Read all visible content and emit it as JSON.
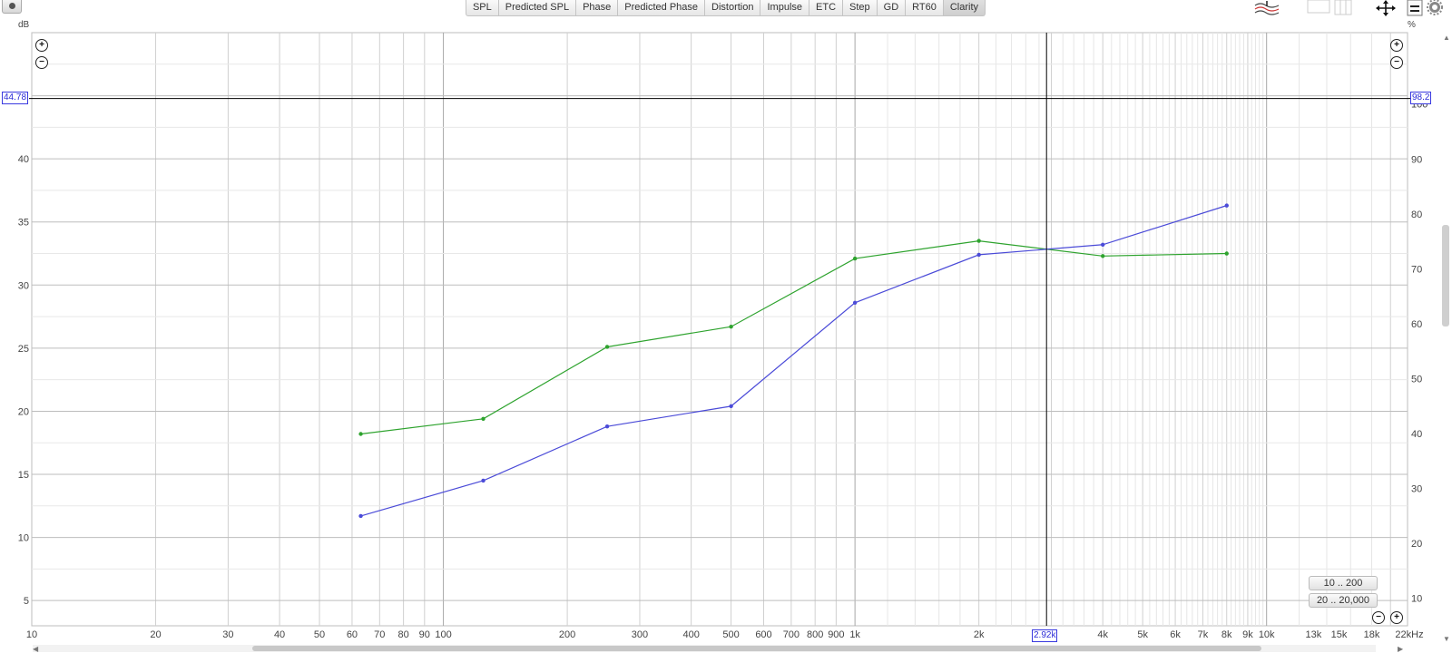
{
  "toolbar": {
    "tabs": [
      "SPL",
      "Predicted SPL",
      "Phase",
      "Predicted Phase",
      "Distortion",
      "Impulse",
      "ETC",
      "Step",
      "GD",
      "RT60",
      "Clarity"
    ],
    "active_tab": "Clarity"
  },
  "axes": {
    "left_unit": "dB",
    "right_unit": "%",
    "x_unit_label": "22kHz"
  },
  "cursor": {
    "y_left": "44.78",
    "y_right": "98.2",
    "x": "2.92k"
  },
  "range_buttons": [
    "10 .. 200",
    "20 .. 20,000"
  ],
  "colors": {
    "series_green": "#2ea32e",
    "series_blue": "#4b4bd8",
    "cursor": "#000000",
    "cursor_box": "#3a3ae0"
  },
  "chart_data": {
    "type": "line",
    "x_scale": "log",
    "xlim": [
      10,
      22000
    ],
    "ylim_left": [
      3,
      50
    ],
    "ylim_right": [
      5,
      113
    ],
    "x_tick_labels": [
      {
        "v": 10,
        "t": "10"
      },
      {
        "v": 20,
        "t": "20"
      },
      {
        "v": 30,
        "t": "30"
      },
      {
        "v": 40,
        "t": "40"
      },
      {
        "v": 50,
        "t": "50"
      },
      {
        "v": 60,
        "t": "60"
      },
      {
        "v": 70,
        "t": "70"
      },
      {
        "v": 80,
        "t": "80"
      },
      {
        "v": 90,
        "t": "90"
      },
      {
        "v": 100,
        "t": "100"
      },
      {
        "v": 200,
        "t": "200"
      },
      {
        "v": 300,
        "t": "300"
      },
      {
        "v": 400,
        "t": "400"
      },
      {
        "v": 500,
        "t": "500"
      },
      {
        "v": 600,
        "t": "600"
      },
      {
        "v": 700,
        "t": "700"
      },
      {
        "v": 800,
        "t": "800"
      },
      {
        "v": 900,
        "t": "900"
      },
      {
        "v": 1000,
        "t": "1k"
      },
      {
        "v": 2000,
        "t": "2k"
      },
      {
        "v": 4000,
        "t": "4k"
      },
      {
        "v": 5000,
        "t": "5k"
      },
      {
        "v": 6000,
        "t": "6k"
      },
      {
        "v": 7000,
        "t": "7k"
      },
      {
        "v": 8000,
        "t": "8k"
      },
      {
        "v": 9000,
        "t": "9k"
      },
      {
        "v": 10000,
        "t": "10k"
      },
      {
        "v": 13000,
        "t": "13k"
      },
      {
        "v": 15000,
        "t": "15k"
      },
      {
        "v": 18000,
        "t": "18k"
      }
    ],
    "y_left_ticks": [
      5,
      10,
      15,
      20,
      25,
      30,
      35,
      40
    ],
    "y_right_ticks": [
      10,
      20,
      30,
      40,
      50,
      60,
      70,
      80,
      90,
      100
    ],
    "cursor_x": 2920,
    "cursor_y": 44.78,
    "series": [
      {
        "color": "#2ea32e",
        "x": [
          63,
          125,
          250,
          500,
          1000,
          2000,
          4000,
          8000
        ],
        "values": [
          18.2,
          19.4,
          25.1,
          26.7,
          32.1,
          33.5,
          32.3,
          32.5
        ]
      },
      {
        "color": "#4b4bd8",
        "x": [
          63,
          125,
          250,
          500,
          1000,
          2000,
          4000,
          8000
        ],
        "values": [
          11.7,
          14.5,
          18.8,
          20.4,
          28.6,
          32.4,
          33.2,
          36.3
        ]
      }
    ],
    "grid": true
  }
}
